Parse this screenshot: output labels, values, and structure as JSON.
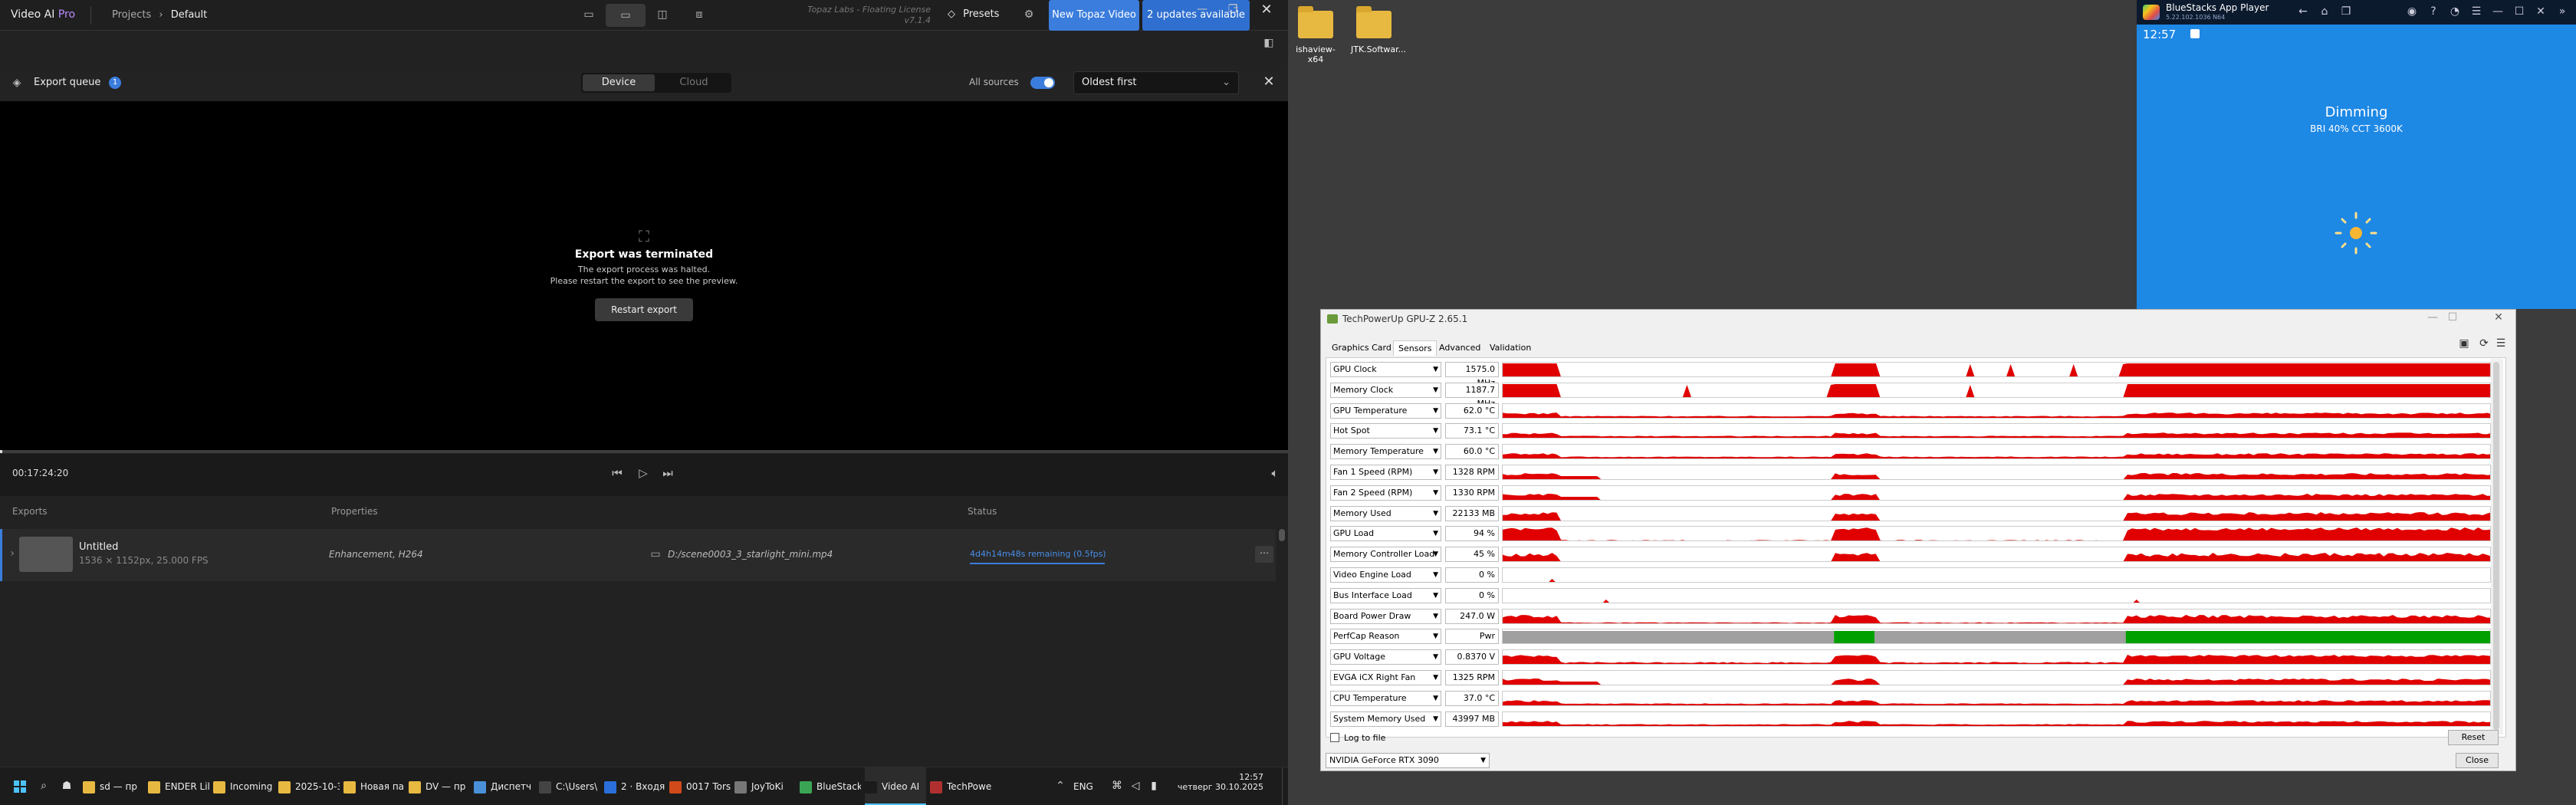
{
  "topaz": {
    "app_name": "Video AI",
    "app_edition": "Pro",
    "breadcrumb_root": "Projects",
    "breadcrumb_current": "Default",
    "license_line1": "Topaz Labs - Floating License",
    "license_line2": "v7.1.4",
    "presets_label": "Presets",
    "new_video_label": "New Topaz Video",
    "updates_label": "2 updates available",
    "export_queue_label": "Export queue",
    "export_queue_badge": "1",
    "tab_device": "Device",
    "tab_cloud": "Cloud",
    "all_sources_label": "All sources",
    "sort_value": "Oldest first",
    "preview_title": "Export was terminated",
    "preview_msg1": "The export process was halted.",
    "preview_msg2": "Please restart the export to see the preview.",
    "restart_label": "Restart export",
    "timecode": "00:17:24:20",
    "col_exports": "Exports",
    "col_properties": "Properties",
    "col_status": "Status",
    "row": {
      "name": "Untitled",
      "meta": "1536 × 1152px, 25.000 FPS",
      "properties": "Enhancement, H264",
      "path": "D:/scene0003_3_starlight_mini.mp4",
      "status": "4d4h14m48s remaining (0.5fps)"
    },
    "accent": "#3b7ddd"
  },
  "desktop": {
    "icons": [
      {
        "label": "ishaview-x64"
      },
      {
        "label": "JTK.Softwar..."
      }
    ]
  },
  "gpuz": {
    "title": "TechPowerUp GPU-Z 2.65.1",
    "tabs": [
      "Graphics Card",
      "Sensors",
      "Advanced",
      "Validation"
    ],
    "sensors": [
      {
        "name": "GPU Clock",
        "value": "1575.0 MHz",
        "color": "#e00000",
        "profile": "clock"
      },
      {
        "name": "Memory Clock",
        "value": "1187.7 MHz",
        "color": "#e00000",
        "profile": "clock"
      },
      {
        "name": "GPU Temperature",
        "value": "62.0 °C",
        "color": "#e00000",
        "profile": "temp"
      },
      {
        "name": "Hot Spot",
        "value": "73.1 °C",
        "color": "#e00000",
        "profile": "temp"
      },
      {
        "name": "Memory Temperature",
        "value": "60.0 °C",
        "color": "#e00000",
        "profile": "temp"
      },
      {
        "name": "Fan 1 Speed (RPM)",
        "value": "1328 RPM",
        "color": "#e00000",
        "profile": "fan"
      },
      {
        "name": "Fan 2 Speed (RPM)",
        "value": "1330 RPM",
        "color": "#e00000",
        "profile": "fan"
      },
      {
        "name": "Memory Used",
        "value": "22133 MB",
        "color": "#e00000",
        "profile": "mem"
      },
      {
        "name": "GPU Load",
        "value": "94 %",
        "color": "#e00000",
        "profile": "load"
      },
      {
        "name": "Memory Controller Load",
        "value": "45 %",
        "color": "#e00000",
        "profile": "load2"
      },
      {
        "name": "Video Engine Load",
        "value": "0 %",
        "color": "#e00000",
        "profile": "zero"
      },
      {
        "name": "Bus Interface Load",
        "value": "0 %",
        "color": "#e00000",
        "profile": "zero"
      },
      {
        "name": "Board Power Draw",
        "value": "247.0 W",
        "color": "#e00000",
        "profile": "power"
      },
      {
        "name": "PerfCap Reason",
        "value": "Pwr",
        "color": "#00a000",
        "profile": "perfcap"
      },
      {
        "name": "GPU Voltage",
        "value": "0.8370 V",
        "color": "#e00000",
        "profile": "volt"
      },
      {
        "name": "EVGA iCX Right Fan",
        "value": "1325 RPM",
        "color": "#e00000",
        "profile": "fan"
      },
      {
        "name": "CPU Temperature",
        "value": "37.0 °C",
        "color": "#e00000",
        "profile": "cpu"
      },
      {
        "name": "System Memory Used",
        "value": "43997 MB",
        "color": "#e00000",
        "profile": "sysmem"
      }
    ],
    "log_to_file": "Log to file",
    "reset_label": "Reset",
    "gpu_select": "NVIDIA GeForce RTX 3090",
    "close_label": "Close"
  },
  "bluestacks": {
    "title": "BlueStacks App Player",
    "subtitle": "5.22.102.1036 N64",
    "time": "12:57",
    "dim_title": "Dimming",
    "dim_sub": "BRI 40% CCT 3600K",
    "bg": "#1e88e5"
  },
  "taskbar": {
    "items": [
      {
        "label": "sd — пр",
        "icon": "folder-icon",
        "color": "#e8b941"
      },
      {
        "label": "ENDER Lil",
        "icon": "folder-icon",
        "color": "#e8b941"
      },
      {
        "label": "Incoming",
        "icon": "folder-icon",
        "color": "#e8b941"
      },
      {
        "label": "2025-10-3",
        "icon": "folder-icon",
        "color": "#e8b941"
      },
      {
        "label": "Новая па",
        "icon": "folder-icon",
        "color": "#e8b941"
      },
      {
        "label": "DV — пр",
        "icon": "folder-icon",
        "color": "#e8b941"
      },
      {
        "label": "Диспетч",
        "icon": "task-manager-icon",
        "color": "#4a90d9"
      },
      {
        "label": "C:\\Users\\",
        "icon": "terminal-icon",
        "color": "#444444"
      },
      {
        "label": "2 · Входя",
        "icon": "mail-icon",
        "color": "#2a6fdb"
      },
      {
        "label": "0017 Torsi",
        "icon": "torrent-icon",
        "color": "#d04a1a"
      },
      {
        "label": "JoyToKi",
        "icon": "gamepad-icon",
        "color": "#777777"
      },
      {
        "label": "BlueStack",
        "icon": "bluestacks-icon",
        "color": "#3aa655"
      },
      {
        "label": "Video AI",
        "icon": "topaz-icon",
        "color": "#1b1b1b"
      },
      {
        "label": "TechPowe",
        "icon": "gpuz-icon",
        "color": "#b03030"
      }
    ],
    "lang": "ENG",
    "time": "12:57",
    "day": "четверг",
    "date": "30.10.2025"
  }
}
